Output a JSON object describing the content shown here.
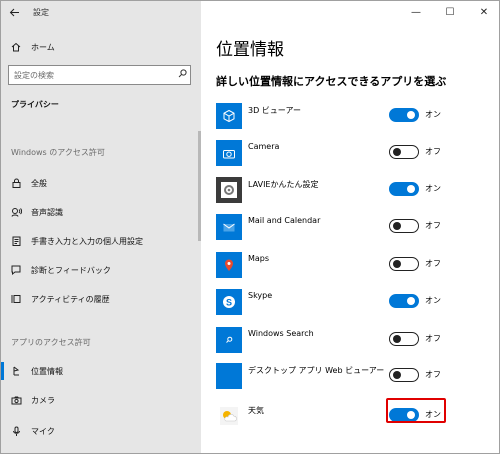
{
  "window": {
    "app_title": "設定",
    "controls": {
      "minimize": "—",
      "maximize": "☐",
      "close": "✕"
    }
  },
  "sidebar": {
    "home_label": "ホーム",
    "search_placeholder": "設定の検索",
    "section_title": "プライバシー",
    "group_windows": "Windows のアクセス許可",
    "windows_items": [
      {
        "label": "全般",
        "icon": "lock-icon"
      },
      {
        "label": "音声認識",
        "icon": "speech-icon"
      },
      {
        "label": "手書き入力と入力の個人用設定",
        "icon": "notepad-icon"
      },
      {
        "label": "診断とフィードバック",
        "icon": "feedback-icon"
      },
      {
        "label": "アクティビティの履歴",
        "icon": "timeline-icon"
      }
    ],
    "group_apps": "アプリのアクセス許可",
    "app_items": [
      {
        "label": "位置情報",
        "icon": "location-icon",
        "selected": true
      },
      {
        "label": "カメラ",
        "icon": "camera-icon"
      },
      {
        "label": "マイク",
        "icon": "microphone-icon"
      }
    ]
  },
  "main": {
    "title": "位置情報",
    "subheading": "詳しい位置情報にアクセスできるアプリを選ぶ",
    "apps": [
      {
        "name": "3D ビューアー",
        "state": "オン",
        "on": true,
        "tile_color": "#0078d7",
        "icon": "cube-icon"
      },
      {
        "name": "Camera",
        "state": "オフ",
        "on": false,
        "tile_color": "#0078d7",
        "icon": "camera-icon"
      },
      {
        "name": "LAVIEかんたん設定",
        "state": "オン",
        "on": true,
        "tile_color": "#3b3b3b",
        "icon": "gear-icon"
      },
      {
        "name": "Mail and Calendar",
        "state": "オフ",
        "on": false,
        "tile_color": "#0078d7",
        "icon": "mail-icon"
      },
      {
        "name": "Maps",
        "state": "オフ",
        "on": false,
        "tile_color": "#0078d7",
        "icon": "map-pin-icon"
      },
      {
        "name": "Skype",
        "state": "オン",
        "on": true,
        "tile_color": "#0078d7",
        "icon": "skype-icon"
      },
      {
        "name": "Windows Search",
        "state": "オフ",
        "on": false,
        "tile_color": "#0078d7",
        "icon": "search-icon"
      },
      {
        "name": "デスクトップ アプリ Web ビューアー",
        "state": "オフ",
        "on": false,
        "tile_color": "#0078d7",
        "icon": "blank-tile-icon"
      },
      {
        "name": "天気",
        "state": "オン",
        "on": true,
        "tile_color": "#ffffff",
        "icon": "weather-icon"
      }
    ]
  },
  "colors": {
    "accent": "#0078d7",
    "highlight": "#e00000",
    "sidebar_bg": "#e6e6e6"
  }
}
